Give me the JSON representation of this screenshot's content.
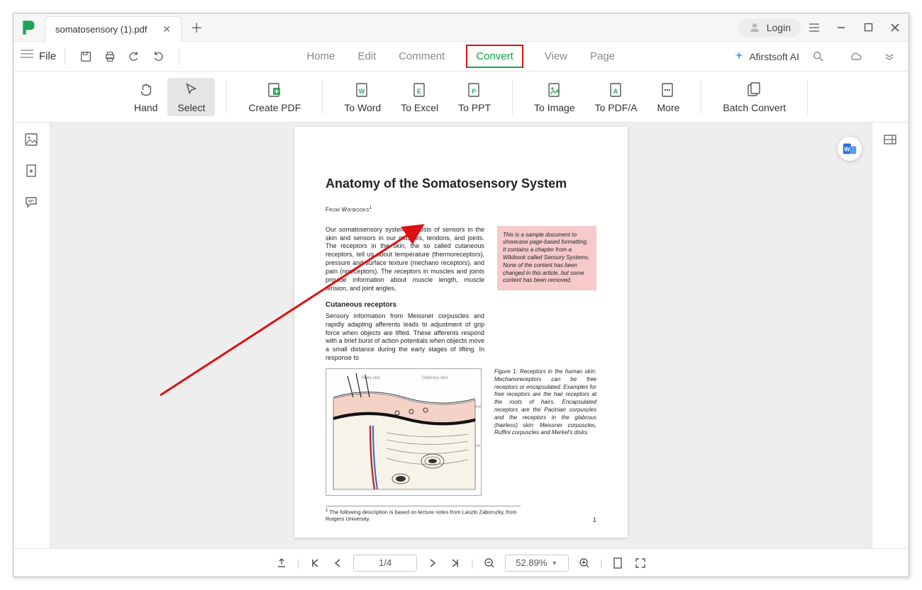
{
  "title": {
    "tab": "somatosensory (1).pdf",
    "login": "Login"
  },
  "menubar": {
    "file": "File",
    "tabs": [
      "Home",
      "Edit",
      "Comment",
      "Convert",
      "View",
      "Page"
    ],
    "active": "Convert",
    "ai": "Afirstsoft AI"
  },
  "toolbar": {
    "hand": "Hand",
    "select": "Select",
    "create": "Create PDF",
    "word": "To Word",
    "excel": "To Excel",
    "ppt": "To PPT",
    "image": "To Image",
    "pdfa": "To PDF/A",
    "more": "More",
    "batch": "Batch Convert"
  },
  "document": {
    "heading": "Anatomy of the Somatosensory System",
    "source": "From Wikibooks",
    "para1": "Our somatosensory system consists of sensors in the skin and sensors in our muscles, tendons, and joints. The receptors in the skin, the so called cutaneous receptors, tell us about temperature (thermoreceptors), pressure and surface texture (mechano receptors), and pain (nociceptors). The receptors in muscles and joints provide information about muscle length, muscle tension, and joint angles.",
    "h2": "Cutaneous receptors",
    "para2": "Sensory information from Meissner corpuscles and rapidly adapting afferents leads to adjustment of grip force when objects are lifted. These afferents respond with a brief burst of action potentials when objects move a small distance during the early stages of lifting. In response to",
    "callout": "This is a sample document to showcase page-based formatting. It contains a chapter from a Wikibook called Sensory Systems. None of the content has been changed in this article, but some content has been removed.",
    "figcap": "Figure 1: Receptors in the human skin: Mechanoreceptors can be free receptors or encapsulated. Examples for free receptors are the hair receptors at the roots of hairs. Encapsulated receptors are the Pacinian corpuscles and the receptors in the glabrous (hairless) skin: Meissner corpuscles, Ruffini corpuscles and Merkel's disks.",
    "footnote": "The following description is based on lecture notes from Laszlo Zaborszky, from Rutgers University.",
    "page_num": "1"
  },
  "status": {
    "page": "1/4",
    "zoom": "52.89%"
  }
}
